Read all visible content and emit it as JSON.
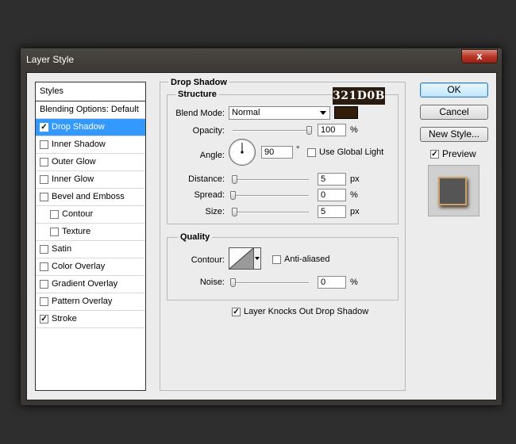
{
  "window": {
    "title": "Layer Style",
    "close_glyph": "x"
  },
  "styles_panel": {
    "header": "Styles",
    "items": [
      {
        "label": "Blending Options: Default",
        "checkbox": false,
        "checked": false,
        "indent": false,
        "selected": false
      },
      {
        "label": "Drop Shadow",
        "checkbox": true,
        "checked": true,
        "indent": false,
        "selected": true
      },
      {
        "label": "Inner Shadow",
        "checkbox": true,
        "checked": false,
        "indent": false,
        "selected": false
      },
      {
        "label": "Outer Glow",
        "checkbox": true,
        "checked": false,
        "indent": false,
        "selected": false
      },
      {
        "label": "Inner Glow",
        "checkbox": true,
        "checked": false,
        "indent": false,
        "selected": false
      },
      {
        "label": "Bevel and Emboss",
        "checkbox": true,
        "checked": false,
        "indent": false,
        "selected": false
      },
      {
        "label": "Contour",
        "checkbox": true,
        "checked": false,
        "indent": true,
        "selected": false
      },
      {
        "label": "Texture",
        "checkbox": true,
        "checked": false,
        "indent": true,
        "selected": false
      },
      {
        "label": "Satin",
        "checkbox": true,
        "checked": false,
        "indent": false,
        "selected": false
      },
      {
        "label": "Color Overlay",
        "checkbox": true,
        "checked": false,
        "indent": false,
        "selected": false
      },
      {
        "label": "Gradient Overlay",
        "checkbox": true,
        "checked": false,
        "indent": false,
        "selected": false
      },
      {
        "label": "Pattern Overlay",
        "checkbox": true,
        "checked": false,
        "indent": false,
        "selected": false
      },
      {
        "label": "Stroke",
        "checkbox": true,
        "checked": true,
        "indent": false,
        "selected": false
      }
    ]
  },
  "drop_shadow": {
    "title": "Drop Shadow",
    "structure": {
      "title": "Structure",
      "blend_mode_label": "Blend Mode:",
      "blend_mode_value": "Normal",
      "shadow_color": "#321D0B",
      "color_hex_label": "321D0B",
      "opacity_label": "Opacity:",
      "opacity_value": "100",
      "opacity_unit": "%",
      "opacity_fraction": 1.0,
      "angle_label": "Angle:",
      "angle_value": "90",
      "angle_unit": "°",
      "use_global_light_label": "Use Global Light",
      "use_global_light_checked": false,
      "distance_label": "Distance:",
      "distance_value": "5",
      "distance_unit": "px",
      "distance_fraction": 0.02,
      "spread_label": "Spread:",
      "spread_value": "0",
      "spread_unit": "%",
      "spread_fraction": 0.0,
      "size_label": "Size:",
      "size_value": "5",
      "size_unit": "px",
      "size_fraction": 0.02
    },
    "quality": {
      "title": "Quality",
      "contour_label": "Contour:",
      "anti_aliased_label": "Anti-aliased",
      "anti_aliased_checked": false,
      "noise_label": "Noise:",
      "noise_value": "0",
      "noise_unit": "%",
      "noise_fraction": 0.0
    },
    "knockout_label": "Layer Knocks Out Drop Shadow",
    "knockout_checked": true
  },
  "buttons": {
    "ok": "OK",
    "cancel": "Cancel",
    "new_style": "New Style..."
  },
  "preview": {
    "label": "Preview",
    "checked": true
  },
  "colors": {
    "selection": "#3399ff",
    "preview_stroke": "#c9a26a"
  }
}
